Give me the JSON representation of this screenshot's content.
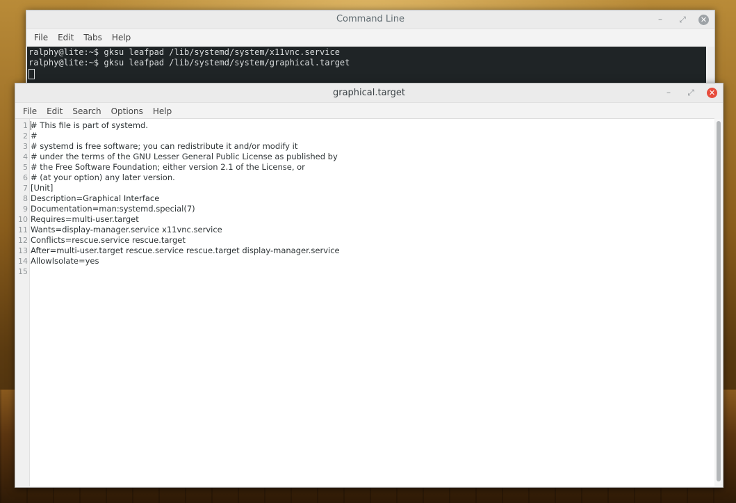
{
  "terminal": {
    "title": "Command Line",
    "menu": [
      "File",
      "Edit",
      "Tabs",
      "Help"
    ],
    "lines": [
      "ralphy@lite:~$ gksu leafpad /lib/systemd/system/x11vnc.service",
      "ralphy@lite:~$ gksu leafpad /lib/systemd/system/graphical.target"
    ]
  },
  "editor": {
    "title": "graphical.target",
    "menu": [
      "File",
      "Edit",
      "Search",
      "Options",
      "Help"
    ],
    "lines": [
      {
        "n": "1",
        "text": "# This file is part of systemd."
      },
      {
        "n": "2",
        "text": "#"
      },
      {
        "n": "3",
        "text": "# systemd is free software; you can redistribute it and/or modify it"
      },
      {
        "n": "4",
        "text": "# under the terms of the GNU Lesser General Public License as published by"
      },
      {
        "n": "5",
        "text": "# the Free Software Foundation; either version 2.1 of the License, or"
      },
      {
        "n": "6",
        "text": "# (at your option) any later version."
      },
      {
        "n": "7",
        "text": "[Unit]"
      },
      {
        "n": "8",
        "text": "Description=Graphical Interface"
      },
      {
        "n": "9",
        "text": "Documentation=man:systemd.special(7)"
      },
      {
        "n": "10",
        "text": "Requires=multi-user.target"
      },
      {
        "n": "11",
        "text": "Wants=display-manager.service x11vnc.service"
      },
      {
        "n": "12",
        "text": "Conflicts=rescue.service rescue.target"
      },
      {
        "n": "13",
        "text": "After=multi-user.target rescue.service rescue.target display-manager.service"
      },
      {
        "n": "14",
        "text": "AllowIsolate=yes"
      },
      {
        "n": "15",
        "text": ""
      }
    ]
  },
  "window_controls": {
    "minimize": "–",
    "maximize": "⤢",
    "close": "✕"
  },
  "colors": {
    "close_active": "#e74c3c",
    "terminal_bg": "#1f2426"
  }
}
